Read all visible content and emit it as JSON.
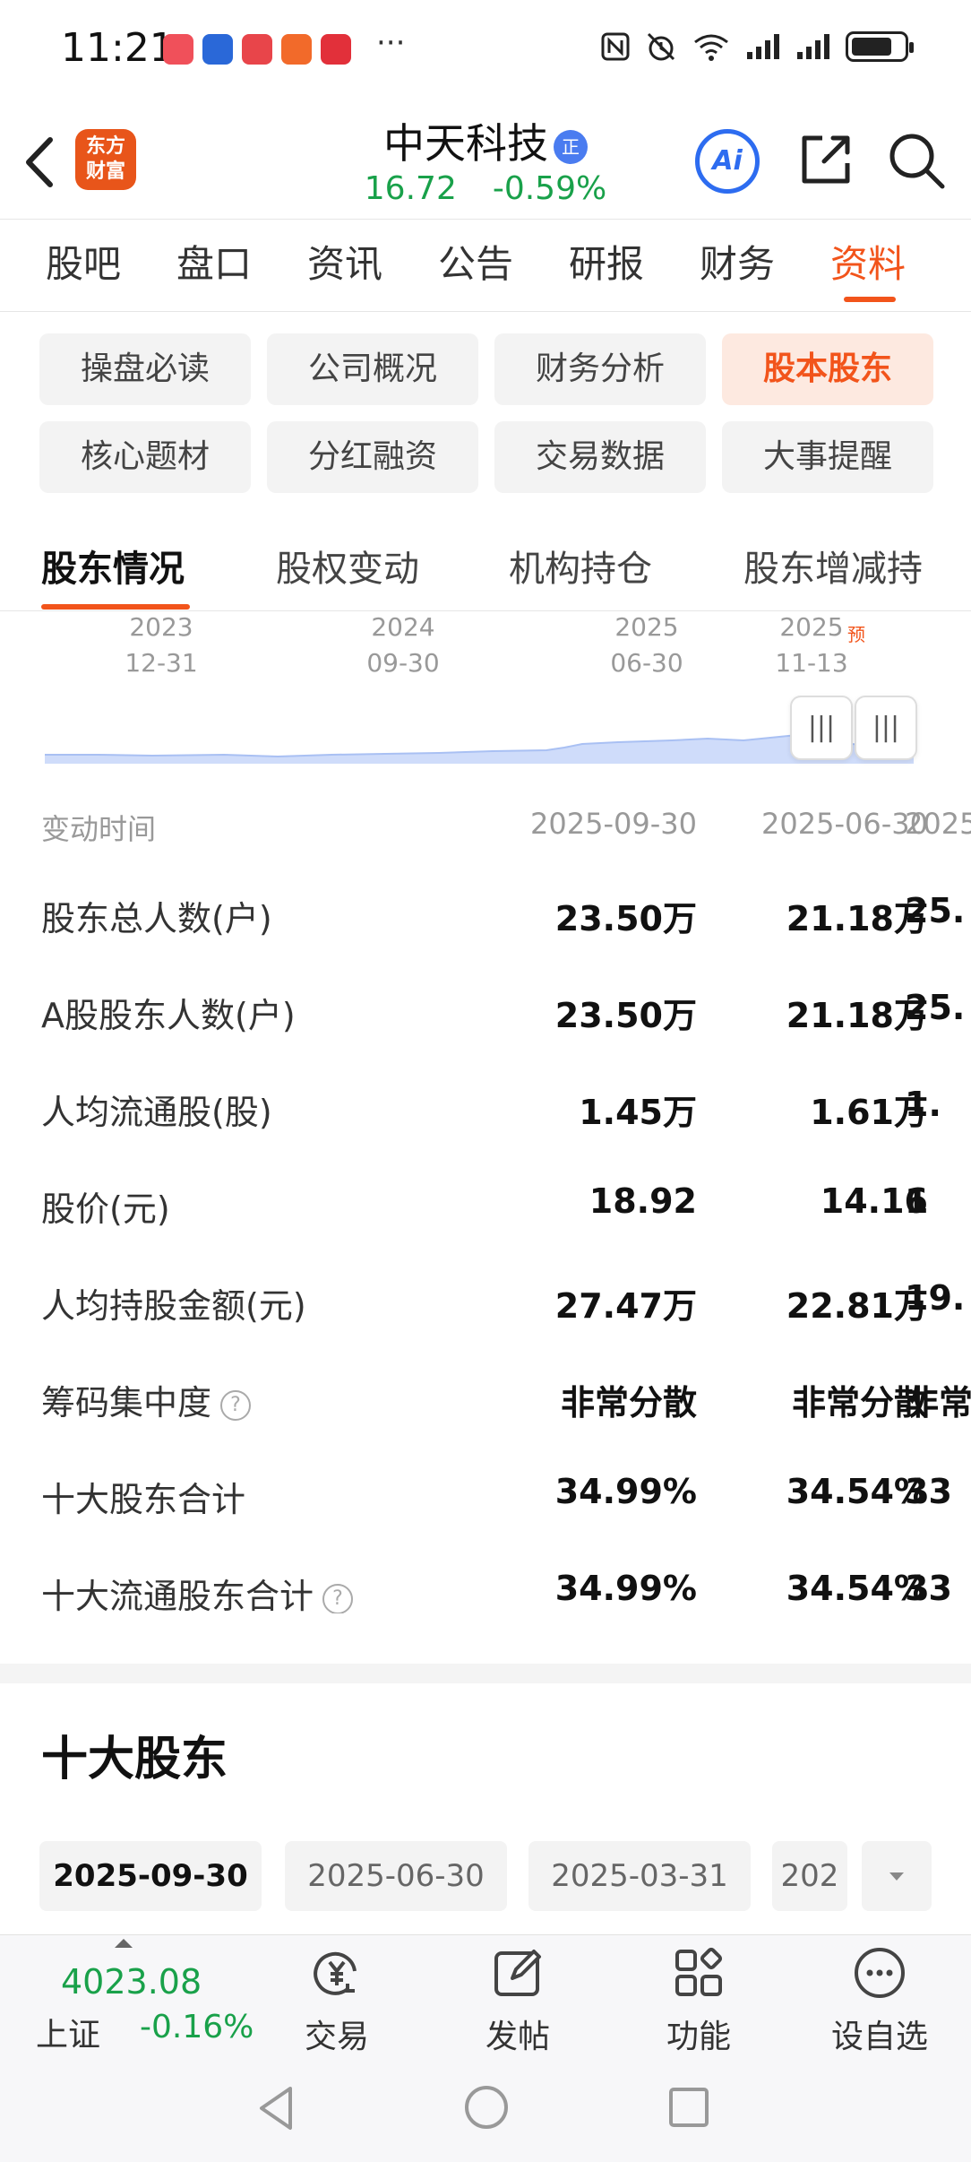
{
  "status_bar": {
    "time": "11:21",
    "more": "···",
    "signal_label": "6"
  },
  "header": {
    "logo_text_1": "东方",
    "logo_text_2": "财富",
    "stock_name": "中天科技",
    "badge": "正",
    "price": "16.72",
    "change": "-0.59%",
    "ai_label": "Ai"
  },
  "main_tabs": [
    "股吧",
    "盘口",
    "资讯",
    "公告",
    "研报",
    "财务",
    "资料"
  ],
  "chips": [
    "操盘必读",
    "公司概况",
    "财务分析",
    "股本股东",
    "核心题材",
    "分红融资",
    "交易数据",
    "大事提醒"
  ],
  "sub_tabs": [
    "股东情况",
    "股权变动",
    "机构持仓",
    "股东增减持"
  ],
  "timeline": {
    "labels": [
      {
        "year": "2023",
        "date": "12-31"
      },
      {
        "year": "2024",
        "date": "09-30"
      },
      {
        "year": "2025",
        "date": "06-30"
      },
      {
        "year": "2025",
        "date": "11-13"
      }
    ],
    "forecast_mark": "预",
    "handle_icon": "|||"
  },
  "table": {
    "header": {
      "label": "变动时间",
      "col1": "2025-09-30",
      "col2": "2025-06-30",
      "col3": "2025-0"
    },
    "rows": [
      {
        "label": "股东总人数(户)",
        "col1": "23.50万",
        "col2": "21.18万",
        "col3": "25."
      },
      {
        "label": "A股股东人数(户)",
        "col1": "23.50万",
        "col2": "21.18万",
        "col3": "25."
      },
      {
        "label": "人均流通股(股)",
        "col1": "1.45万",
        "col2": "1.61万",
        "col3": "1."
      },
      {
        "label": "股价(元)",
        "col1": "18.92",
        "col2": "14.16",
        "col3": "1"
      },
      {
        "label": "人均持股金额(元)",
        "col1": "27.47万",
        "col2": "22.81万",
        "col3": "19."
      },
      {
        "label": "筹码集中度",
        "col1": "非常分散",
        "col2": "非常分散",
        "col3": "非常"
      },
      {
        "label": "十大股东合计",
        "col1": "34.99%",
        "col2": "34.54%",
        "col3": "33"
      },
      {
        "label": "十大流通股东合计",
        "col1": "34.99%",
        "col2": "34.54%",
        "col3": "33"
      }
    ],
    "help_glyph": "?"
  },
  "top10": {
    "title": "十大股东",
    "dates": [
      "2025-09-30",
      "2025-06-30",
      "2025-03-31",
      "202"
    ]
  },
  "bottom_bar": {
    "index_value": "4023.08",
    "index_name": "上证",
    "index_change": "-0.16%",
    "items": [
      "交易",
      "发帖",
      "功能",
      "设自选"
    ]
  },
  "colors": {
    "accent": "#f2541b",
    "down_green": "#19a14a",
    "ai_blue": "#2d6cf0"
  }
}
